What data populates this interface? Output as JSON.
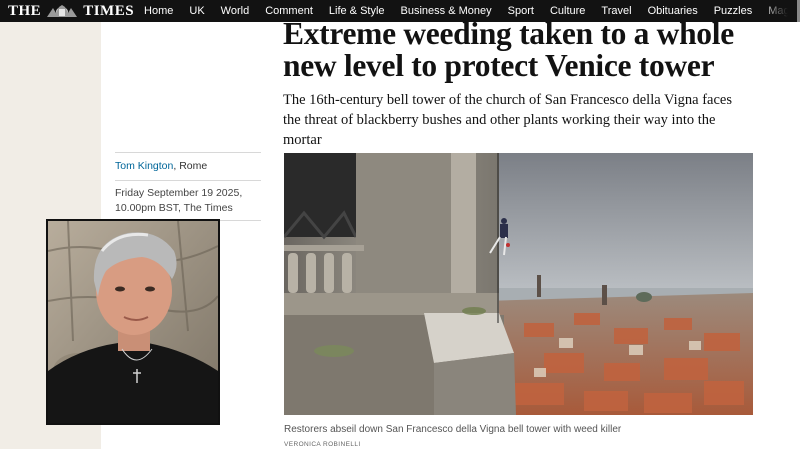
{
  "nav": {
    "masthead": {
      "left": "THE",
      "right": "TIMES"
    },
    "links": [
      "Home",
      "UK",
      "World",
      "Comment",
      "Life & Style",
      "Business & Money",
      "Sport",
      "Culture",
      "Travel",
      "Obituaries",
      "Puzzles",
      "Magazines"
    ]
  },
  "article": {
    "headline": "Extreme weeding taken to a whole new level to protect Venice tower",
    "standfirst": "The 16th-century bell tower of the church of San Francesco della Vigna faces the threat of blackberry bushes and other plants working their way into the mortar",
    "author": "Tom Kington",
    "location": ", Rome",
    "date_line1": "Friday September 19 2025,",
    "date_line2": "10.00pm BST, The Times",
    "caption": "Restorers abseil down San Francesco della Vigna bell tower with weed killer",
    "credit": "VERONICA ROBINELLI"
  },
  "colors": {
    "navbar": "#121212",
    "left_column": "#f1ede6",
    "author_link": "#006699"
  }
}
